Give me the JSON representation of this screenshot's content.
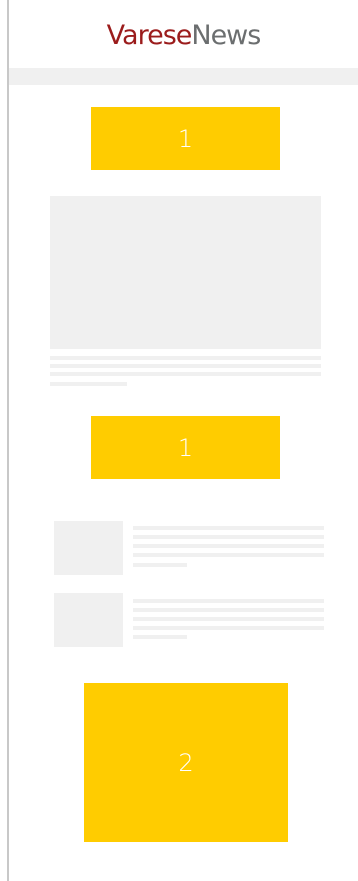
{
  "header": {
    "logo_part1": "Varese",
    "logo_part2": "News"
  },
  "ads": [
    {
      "label": "1"
    },
    {
      "label": "1"
    },
    {
      "label": "2"
    }
  ],
  "colors": {
    "ad_slot": "#ffcc00",
    "placeholder": "#f0f0f0",
    "logo_red": "#9b1c1c",
    "logo_gray": "#6b6e6f"
  }
}
